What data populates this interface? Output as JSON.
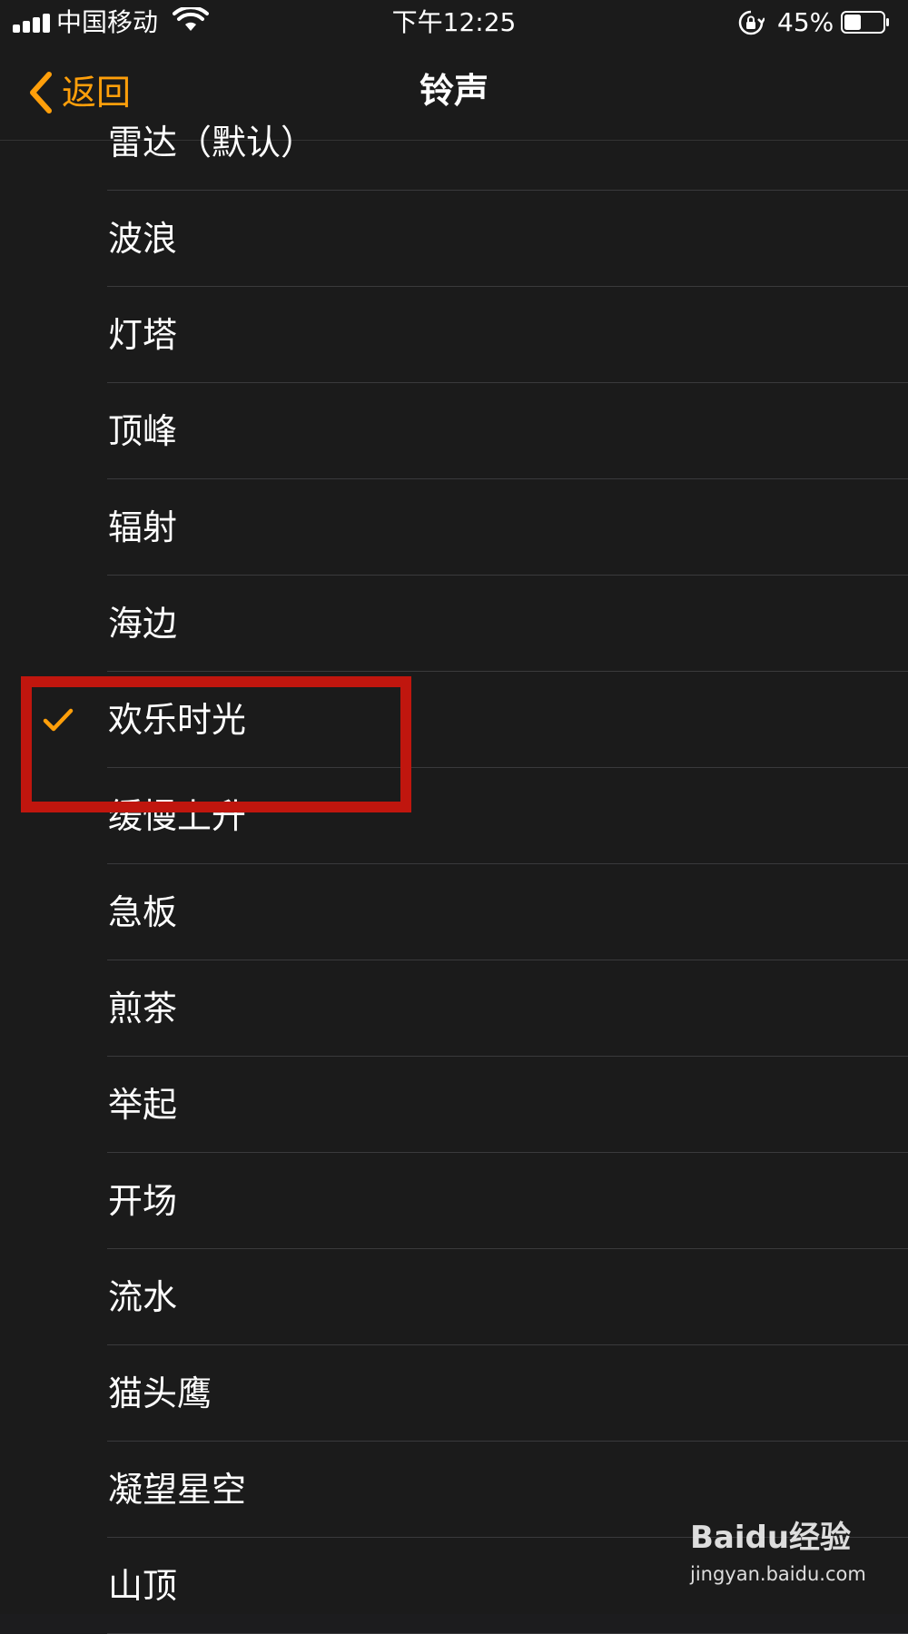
{
  "status_bar": {
    "carrier": "中国移动",
    "time": "下午12:25",
    "battery_percent": "45%",
    "battery_level": 0.45,
    "icons": [
      "signal-icon",
      "wifi-icon",
      "rotation-lock-icon",
      "battery-icon"
    ]
  },
  "nav": {
    "back_label": "返回",
    "title": "铃声"
  },
  "accent_color": "#ff9f0a",
  "ringtones": [
    {
      "label": "雷达（默认）",
      "selected": false
    },
    {
      "label": "波浪",
      "selected": false
    },
    {
      "label": "灯塔",
      "selected": false
    },
    {
      "label": "顶峰",
      "selected": false
    },
    {
      "label": "辐射",
      "selected": false
    },
    {
      "label": "海边",
      "selected": false
    },
    {
      "label": "欢乐时光",
      "selected": true
    },
    {
      "label": "缓慢上升",
      "selected": false
    },
    {
      "label": "急板",
      "selected": false
    },
    {
      "label": "煎茶",
      "selected": false
    },
    {
      "label": "举起",
      "selected": false
    },
    {
      "label": "开场",
      "selected": false
    },
    {
      "label": "流水",
      "selected": false
    },
    {
      "label": "猫头鹰",
      "selected": false
    },
    {
      "label": "凝望星空",
      "selected": false
    },
    {
      "label": "山顶",
      "selected": false
    }
  ],
  "watermark": {
    "brand": "Baidu经验",
    "url": "jingyan.baidu.com"
  }
}
